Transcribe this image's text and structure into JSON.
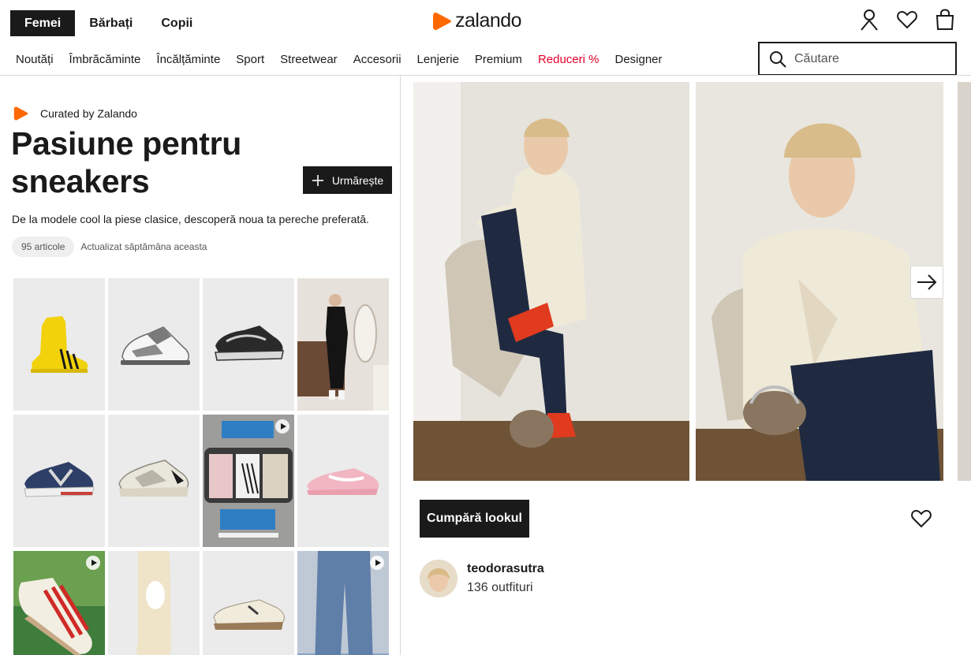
{
  "header": {
    "gender_tabs": [
      {
        "label": "Femei",
        "active": true
      },
      {
        "label": "Bărbați",
        "active": false
      },
      {
        "label": "Copii",
        "active": false
      }
    ],
    "logo_text": "zalando",
    "icons": [
      "user-icon",
      "heart-icon",
      "bag-icon"
    ],
    "search_placeholder": "Căutare"
  },
  "nav": {
    "items": [
      {
        "label": "Noutăți"
      },
      {
        "label": "Îmbrăcăminte"
      },
      {
        "label": "Încălțăminte"
      },
      {
        "label": "Sport"
      },
      {
        "label": "Streetwear"
      },
      {
        "label": "Accesorii"
      },
      {
        "label": "Lenjerie"
      },
      {
        "label": "Premium"
      },
      {
        "label": "Reduceri %"
      },
      {
        "label": "Designer"
      }
    ],
    "sale_color": "#e4002b"
  },
  "collection": {
    "curated_label": "Curated by Zalando",
    "title": "Pasiune pentru sneakers",
    "follow_label": "Urmărește",
    "description": "De la modele cool la piese clasice, descoperă noua ta pereche preferată.",
    "article_count": "95 articole",
    "updated": "Actualizat săptămâna aceasta"
  },
  "outfit": {
    "buy_label": "Cumpără lookul",
    "creator_name": "teodorasutra",
    "creator_outfits": "136 outfituri"
  },
  "colors": {
    "brand_orange": "#ff6900",
    "primary": "#1a1a1a"
  }
}
